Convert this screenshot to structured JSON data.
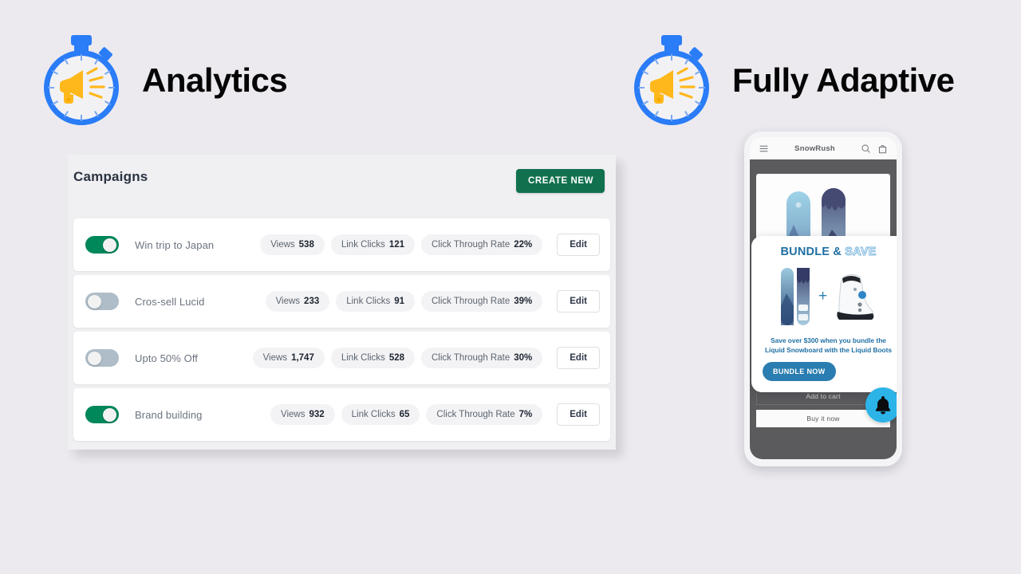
{
  "headings": [
    {
      "id": "analytics",
      "text": "Analytics",
      "icon": "stopwatch-megaphone-icon"
    },
    {
      "id": "adaptive",
      "text": "Fully Adaptive",
      "icon": "stopwatch-megaphone-icon"
    }
  ],
  "colors": {
    "page_background": "#eceaef",
    "panel_background": "#f0f0f3",
    "accent_green": "#11714f",
    "toggle_on": "#00875a",
    "toggle_off": "#aebdc8",
    "icon_blue": "#2a7cf7",
    "icon_yellow": "#ffb81c",
    "bundle_blue": "#2a7db0",
    "bell_blue": "#2cb4e8"
  },
  "campaigns_panel": {
    "title": "Campaigns",
    "create_button": "CREATE NEW",
    "metric_labels": {
      "views": "Views",
      "link_clicks": "Link Clicks",
      "ctr": "Click  Through Rate"
    },
    "edit_label": "Edit",
    "rows": [
      {
        "name": "Win trip to Japan",
        "enabled": true,
        "views": "538",
        "link_clicks": "121",
        "ctr": "22%"
      },
      {
        "name": "Cros-sell Lucid",
        "enabled": false,
        "views": "233",
        "link_clicks": "91",
        "ctr": "39%"
      },
      {
        "name": "Upto 50% Off",
        "enabled": false,
        "views": "1,747",
        "link_clicks": "528",
        "ctr": "30%"
      },
      {
        "name": "Brand building",
        "enabled": true,
        "views": "932",
        "link_clicks": "65",
        "ctr": "7%"
      }
    ]
  },
  "phone": {
    "store_name": "SnowRush",
    "icons": {
      "menu": "hamburger-menu-icon",
      "search": "search-icon",
      "cart": "shopping-bag-icon"
    },
    "actions": {
      "add_to_cart": "Add to cart",
      "buy_it_now": "Buy it now"
    },
    "bundle_popup": {
      "title_part1": "BUNDLE &",
      "title_part2": "SAVE",
      "plus": "+",
      "description": "Save over $300 when you bundle the Liquid Snowboard with the Liquid Boots",
      "cta": "BUNDLE NOW",
      "products": [
        "snowboard-image",
        "snowboard-boot-image"
      ]
    },
    "bell": "notification-bell-icon"
  }
}
